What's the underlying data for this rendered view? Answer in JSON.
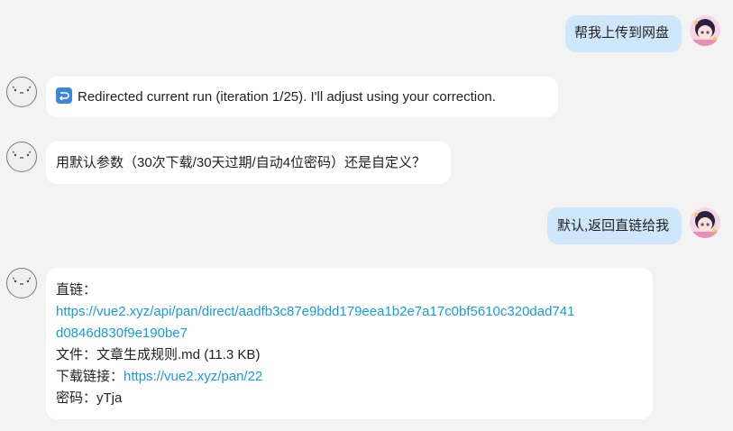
{
  "messages": [
    {
      "role": "user",
      "text": "帮我上传到网盘"
    },
    {
      "role": "bot",
      "icon": "redirect-arrow-icon",
      "text": "Redirected current run (iteration 1/25). I'll adjust using your correction."
    },
    {
      "role": "bot",
      "text": "用默认参数（30次下载/30天过期/自动4位密码）还是自定义？"
    },
    {
      "role": "user",
      "text": "默认,返回直链给我"
    },
    {
      "role": "bot",
      "direct_label": "直链：",
      "direct_url_line1": "https://vue2.xyz/api/pan/direct/aadfb3c87e9bdd179eea1b2e7a17c0bf5610c320dad741",
      "direct_url_line2": "d0846d830f9e190be7",
      "file_label": "文件：",
      "file_value": "文章生成规则.md (11.3 KB)",
      "download_label": "下载链接：",
      "download_url": "https://vue2.xyz/pan/22",
      "password_label": "密码：",
      "password_value": "yTja"
    }
  ],
  "colors": {
    "background": "#f3f3f3",
    "user_bubble": "#cfe7fb",
    "bot_bubble": "#ffffff",
    "link": "#1a9bdc"
  }
}
